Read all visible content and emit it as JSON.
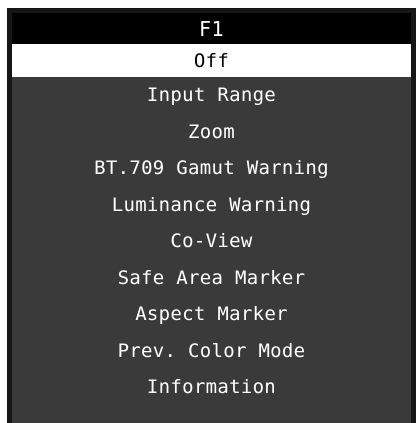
{
  "menu": {
    "title": "F1",
    "items": [
      {
        "label": "Off",
        "selected": true
      },
      {
        "label": "Input Range"
      },
      {
        "label": "Zoom"
      },
      {
        "label": "BT.709 Gamut Warning"
      },
      {
        "label": "Luminance Warning"
      },
      {
        "label": "Co-View"
      },
      {
        "label": "Safe Area Marker"
      },
      {
        "label": "Aspect Marker"
      },
      {
        "label": "Prev. Color Mode"
      },
      {
        "label": "Information"
      }
    ]
  },
  "colors": {
    "frame": "#161616",
    "panel": "#3a3a3a",
    "title_bg": "#000000",
    "selected_bg": "#ffffff",
    "text": "#ffffff",
    "selected_text": "#000000"
  }
}
